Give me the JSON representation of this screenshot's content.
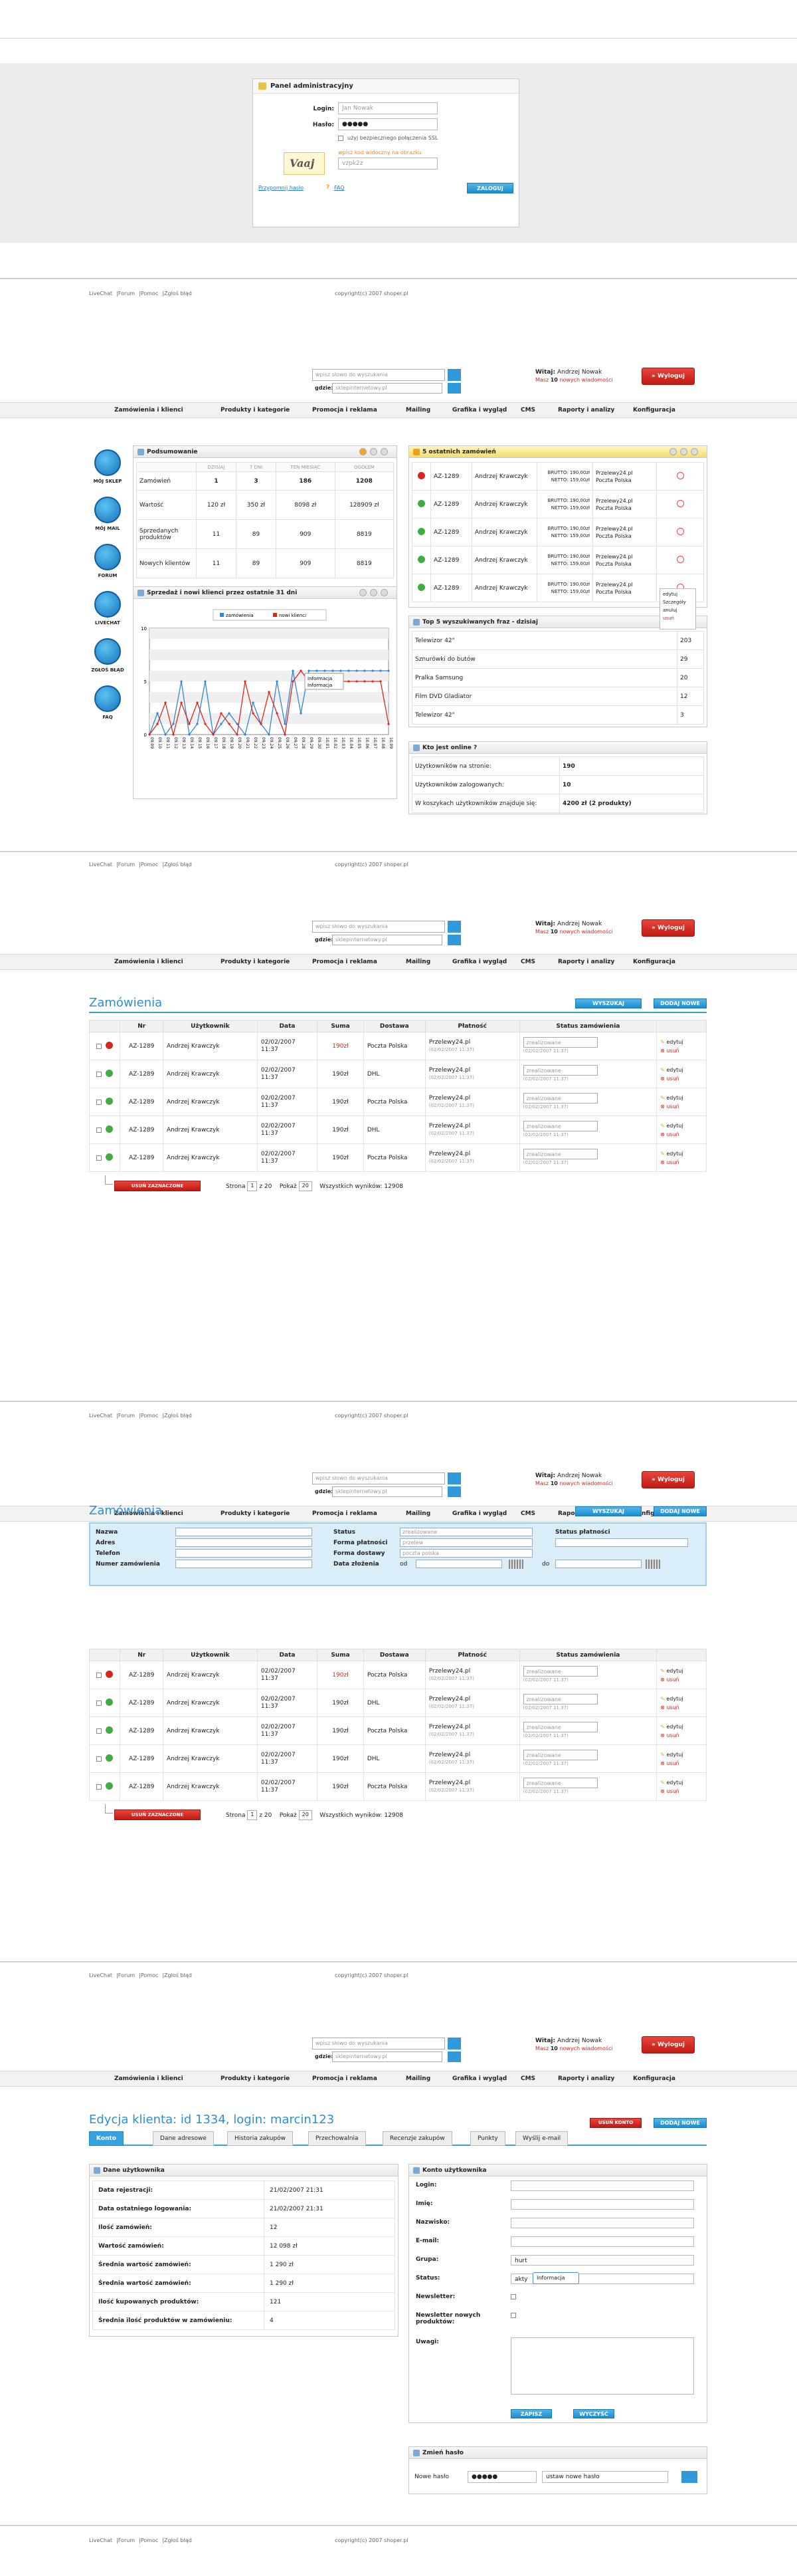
{
  "login": {
    "title": "Panel administracyjny",
    "login_label": "Login:",
    "login_value": "Jan Nowak",
    "password_label": "Hasło:",
    "password_value": "●●●●●",
    "ssl_label": "użyj bezpiecznego połączenia SSL",
    "captcha_image_text": "Vaaj",
    "captcha_hint": "wpisz kod widoczny na obrazku",
    "captcha_value": "vzpk2z",
    "submit": "ZALOGUJ",
    "forgot": "Przypomnij hasło",
    "faq": "FAQ"
  },
  "footer": {
    "links": [
      "LiveChat",
      "Forum",
      "Pomoc",
      "Zgłoś błąd"
    ],
    "copyright": "copyright(c) 2007 shoper.pl"
  },
  "header": {
    "search_placeholder": "wpisz słowo do wyszukania",
    "where_label": "gdzie:",
    "where_value": "sklepinternetowy.pl",
    "welcome_label": "Witaj:",
    "user": "Andrzej Nowak",
    "messages_prefix": "Masz",
    "messages_count": "10",
    "messages_suffix": "nowych wiadomości",
    "logout": "Wyloguj"
  },
  "menu": [
    "Zamówienia i klienci",
    "Produkty i kategorie",
    "Promocja i reklama",
    "Mailing",
    "Grafika i wygląd",
    "CMS",
    "Raporty i analizy",
    "Konfiguracja"
  ],
  "dashboard": {
    "sidebar": [
      "MÓJ SKLEP",
      "MÓJ MAIL",
      "FORUM",
      "LIVECHAT",
      "ZGŁOŚ BŁĄD",
      "FAQ"
    ],
    "summary": {
      "title": "Podsumowanie",
      "cols": [
        "DZISIAJ",
        "7 DNI",
        "TEN MIESIĄC",
        "OGÓŁEM"
      ],
      "rows": [
        {
          "label": "Zamówień",
          "values": [
            "1",
            "3",
            "186",
            "1208"
          ]
        },
        {
          "label": "Wartość",
          "values": [
            "120 zł",
            "350 zł",
            "8098 zł",
            "128909 zł"
          ]
        },
        {
          "label": "Sprzedanych produktów",
          "values": [
            "11",
            "89",
            "909",
            "8819"
          ]
        },
        {
          "label": "Nowych klientów",
          "values": [
            "11",
            "89",
            "909",
            "8819"
          ]
        }
      ]
    },
    "last_orders": {
      "title": "5 ostatnich zamówień",
      "rows": [
        {
          "status": "err",
          "id": "AZ-1289",
          "name": "Andrzej Krawczyk",
          "brutto": "BRUTTO: 190,00zł",
          "netto": "NETTO: 159,00zł",
          "pay": "Przelewy24.pl",
          "ship": "Poczta Polska"
        },
        {
          "status": "ok",
          "id": "AZ-1289",
          "name": "Andrzej Krawczyk",
          "brutto": "BRUTTO: 190,00zł",
          "netto": "NETTO: 159,00zł",
          "pay": "Przelewy24.pl",
          "ship": "Poczta Polska"
        },
        {
          "status": "ok",
          "id": "AZ-1289",
          "name": "Andrzej Krawczyk",
          "brutto": "BRUTTO: 190,00zł",
          "netto": "NETTO: 159,00zł",
          "pay": "Przelewy24.pl",
          "ship": "Poczta Polska"
        },
        {
          "status": "ok",
          "id": "AZ-1289",
          "name": "Andrzej Krawczyk",
          "brutto": "BRUTTO: 190,00zł",
          "netto": "NETTO: 159,00zł",
          "pay": "Przelewy24.pl",
          "ship": "Poczta Polska"
        },
        {
          "status": "ok",
          "id": "AZ-1289",
          "name": "Andrzej Krawczyk",
          "brutto": "BRUTTO: 190,00zł",
          "netto": "NETTO: 159,00zł",
          "pay": "Przelewy24.pl",
          "ship": "Poczta Polska"
        }
      ],
      "context_menu": [
        "edytuj",
        "Szczegóły",
        "anuluj",
        "usuń"
      ]
    },
    "top_search": {
      "title": "Top 5 wyszukiwanych fraz - dzisiaj",
      "rows": [
        {
          "phrase": "Telewizor 42\"",
          "count": "203"
        },
        {
          "phrase": "Sznurówki do butów",
          "count": "29"
        },
        {
          "phrase": "Pralka Samsung",
          "count": "20"
        },
        {
          "phrase": "Film DVD Gladiator",
          "count": "12"
        },
        {
          "phrase": "Telewizor 42\"",
          "count": "3"
        }
      ]
    },
    "online": {
      "title": "Kto jest online ?",
      "rows": [
        {
          "label": "Użytkowników na stronie:",
          "value": "190"
        },
        {
          "label": "Użytkowników zalogowanych:",
          "value": "10"
        },
        {
          "label": "W koszykach użytkowników znajduje się:",
          "value": "4200 zł (2 produkty)"
        }
      ]
    },
    "chart_title": "Sprzedaż i nowi klienci przez ostatnie 31 dni",
    "tooltip": "Informacja"
  },
  "chart_data": {
    "type": "line",
    "title": "Sprzedaż i nowi klienci przez ostatnie 31 dni",
    "legend": [
      "zamówienia",
      "nowi klienci"
    ],
    "legend_position": "top",
    "x": [
      "09.09",
      "09.10",
      "09.11",
      "09.12",
      "09.13",
      "09.14",
      "09.15",
      "09.16",
      "09.17",
      "09.18",
      "09.19",
      "09.20",
      "09.21",
      "09.22",
      "09.23",
      "09.24",
      "09.25",
      "09.26",
      "09.27",
      "09.28",
      "09.29",
      "09.30",
      "10.01",
      "10.02",
      "10.03",
      "10.04",
      "10.05",
      "10.06",
      "10.07",
      "10.08",
      "10.09"
    ],
    "ylim": [
      0,
      10
    ],
    "yticks": [
      "0",
      "5",
      "10"
    ],
    "series": [
      {
        "name": "zamówienia",
        "color": "#2f86d6",
        "values": [
          0,
          2,
          0,
          1,
          5,
          0,
          1,
          5,
          0,
          1,
          2,
          1,
          0,
          3,
          1,
          0,
          5,
          1,
          6,
          2,
          6,
          6,
          6,
          6,
          6,
          6,
          6,
          6,
          6,
          6,
          6
        ]
      },
      {
        "name": "nowi klienci",
        "color": "#e0241b",
        "values": [
          0,
          1,
          3,
          0,
          3,
          1,
          3,
          1,
          0,
          2,
          1,
          0,
          5,
          2,
          1,
          4,
          2,
          0,
          5,
          6,
          5,
          5,
          5,
          5,
          5,
          5,
          5,
          5,
          5,
          5,
          1
        ]
      }
    ]
  },
  "orders_page": {
    "title": "Zamówienia",
    "btn_search": "WYSZUKAJ",
    "btn_add": "DODAJ NOWE",
    "columns": [
      "",
      "Nr",
      "Użytkownik",
      "Data",
      "Suma",
      "Dostawa",
      "Płatność",
      "Status zamówienia",
      ""
    ],
    "rows": [
      {
        "status": "err",
        "nr": "AZ-1289",
        "user": "Andrzej Krawczyk",
        "date": "02/02/2007 11:37",
        "sum": "190zł",
        "ship": "Poczta Polska",
        "pay": "Przelewy24.pl",
        "pay_date": "(02/02/2007 11:37)",
        "order_status": "zrealizowane",
        "status_date": "(02/02/2007 11:37)"
      },
      {
        "status": "ok",
        "nr": "AZ-1289",
        "user": "Andrzej Krawczyk",
        "date": "02/02/2007 11:37",
        "sum": "190zł",
        "ship": "DHL",
        "pay": "Przelewy24.pl",
        "pay_date": "(02/02/2007 11:37)",
        "order_status": "zrealizowane",
        "status_date": "(02/02/2007 11:37)"
      },
      {
        "status": "ok",
        "nr": "AZ-1289",
        "user": "Andrzej Krawczyk",
        "date": "02/02/2007 11:37",
        "sum": "190zł",
        "ship": "Poczta Polska",
        "pay": "Przelewy24.pl",
        "pay_date": "(02/02/2007 11:37)",
        "order_status": "zrealizowane",
        "status_date": "(02/02/2007 11:37)"
      },
      {
        "status": "ok",
        "nr": "AZ-1289",
        "user": "Andrzej Krawczyk",
        "date": "02/02/2007 11:37",
        "sum": "190zł",
        "ship": "DHL",
        "pay": "Przelewy24.pl",
        "pay_date": "(02/02/2007 11:37)",
        "order_status": "zrealizowane",
        "status_date": "(02/02/2007 11:37)"
      },
      {
        "status": "ok",
        "nr": "AZ-1289",
        "user": "Andrzej Krawczyk",
        "date": "02/02/2007 11:37",
        "sum": "190zł",
        "ship": "Poczta Polska",
        "pay": "Przelewy24.pl",
        "pay_date": "(02/02/2007 11:37)",
        "order_status": "zrealizowane",
        "status_date": "(02/02/2007 11:37)"
      }
    ],
    "edit": "edytuj",
    "delete": "usuń",
    "delete_selected": "USUŃ ZAZNACZONE",
    "page_label": "Strona",
    "page_value": "1",
    "page_of": "z 20",
    "show_label": "Pokaż",
    "show_value": "20",
    "results_label": "Wszystkich wyników:",
    "results_value": "12908"
  },
  "filter": {
    "name": "Nazwa",
    "address": "Adres",
    "phone": "Telefon",
    "account": "Numer zamówienia",
    "status": "Status",
    "status_value": "zrealizowane",
    "payment": "Forma płatności",
    "payment_value": "przelew",
    "delivery": "Forma dostawy",
    "delivery_value": "poczta polska",
    "date": "Data złożenia",
    "from": "od",
    "to": "do",
    "pay_status": "Status płatności"
  },
  "customer": {
    "title": "Edycja klienta: id 1334, login: marcin123",
    "btn_delete": "USUŃ KONTO",
    "btn_add": "DODAJ NOWE",
    "tabs": [
      "Konto",
      "Dane adresowe",
      "Historia zakupów",
      "Przechowalnia",
      "Recenzje zakupów",
      "Punkty",
      "Wyślij e-mail"
    ],
    "data_title": "Dane użytkownika",
    "data": [
      {
        "k": "Data rejestracji:",
        "v": "21/02/2007 21:31"
      },
      {
        "k": "Data ostatniego logowania:",
        "v": "21/02/2007 21:31"
      },
      {
        "k": "Ilość zamówień:",
        "v": "12"
      },
      {
        "k": "Wartość zamówień:",
        "v": "12 098 zł"
      },
      {
        "k": "Średnia wartość zamówień:",
        "v": "1 290 zł"
      },
      {
        "k": "Średnia wartość zamówień:",
        "v": "1 290 zł"
      },
      {
        "k": "Ilość kupowanych produktów:",
        "v": "121"
      },
      {
        "k": "Średnia ilość produktów w zamówieniu:",
        "v": "4"
      }
    ],
    "account_title": "Konto użytkownika",
    "fields": [
      "Login:",
      "Imię:",
      "Nazwisko:",
      "E-mail:",
      "Grupa:",
      "Status:",
      "Newsletter:",
      "Newsletter nowych produktów:",
      "Uwagi:"
    ],
    "group_value": "hurt",
    "status_value": "akty",
    "status_tip": "Informacja",
    "btn_save": "ZAPISZ",
    "btn_cancel": "WYCZYŚĆ",
    "pass_title": "Zmień hasło",
    "pass_label": "Nowe hasło",
    "pass_value": "●●●●●",
    "pass_select": "ustaw nowe hasło"
  }
}
